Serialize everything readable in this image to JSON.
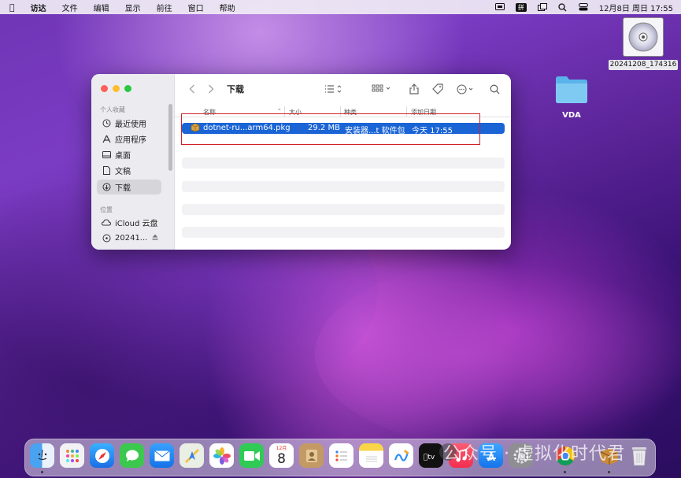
{
  "menubar": {
    "app": "访达",
    "items": [
      "文件",
      "编辑",
      "显示",
      "前往",
      "窗口",
      "帮助"
    ],
    "input_method": "拼",
    "datetime": "12月8日 周日  17:55"
  },
  "desktop": {
    "disc_label": "20241208_174316",
    "folder_label": "VDA"
  },
  "finder": {
    "title": "下载",
    "sidebar": {
      "favorites_label": "个人收藏",
      "favorites": [
        "最近使用",
        "应用程序",
        "桌面",
        "文稿",
        "下载"
      ],
      "locations_label": "位置",
      "locations": [
        "iCloud 云盘",
        "20241..."
      ]
    },
    "columns": {
      "name": "名称",
      "size": "大小",
      "kind": "种类",
      "date_added": "添加日期"
    },
    "file": {
      "name": "dotnet-ru...arm64.pkg",
      "size": "29.2 MB",
      "kind": "安装器...t 软件包",
      "date": "今天 17:55"
    }
  },
  "dock": {
    "calendar_month": "12月",
    "calendar_day": "8",
    "watermark": "公众号 · 虚拟化时代君"
  }
}
